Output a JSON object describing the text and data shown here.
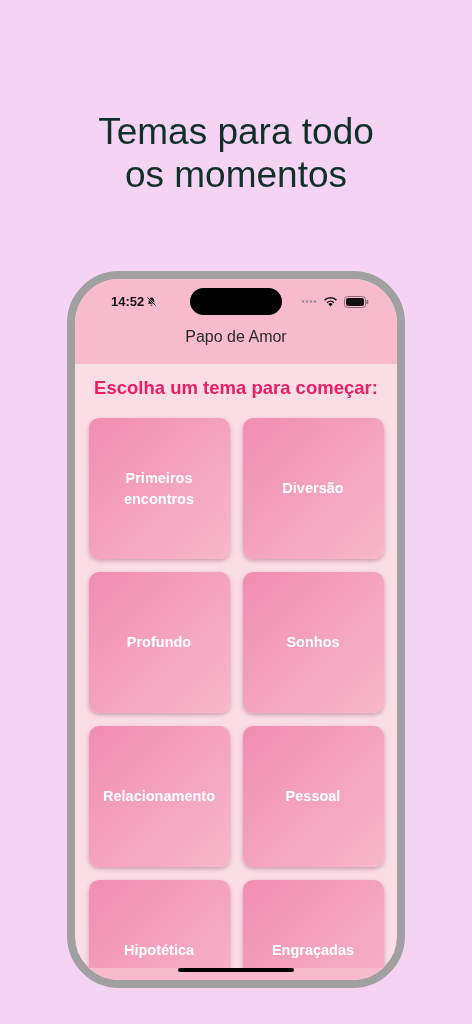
{
  "headline": "Temas para todo\nos momentos",
  "status_bar": {
    "time": "14:52"
  },
  "app_bar": {
    "title": "Papo de Amor"
  },
  "prompt": "Escolha um tema para começar:",
  "themes": [
    {
      "label": "Primeiros\nencontros"
    },
    {
      "label": "Diversão"
    },
    {
      "label": "Profundo"
    },
    {
      "label": "Sonhos"
    },
    {
      "label": "Relacionamento"
    },
    {
      "label": "Pessoal"
    },
    {
      "label": "Hipotética"
    },
    {
      "label": "Engraçadas"
    }
  ]
}
